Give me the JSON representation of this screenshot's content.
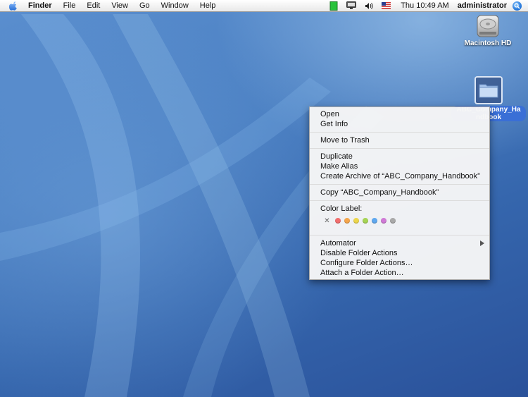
{
  "menubar": {
    "app_name": "Finder",
    "menus": [
      "File",
      "Edit",
      "View",
      "Go",
      "Window",
      "Help"
    ],
    "clock": "Thu 10:49 AM",
    "user": "administrator",
    "status_icons": [
      "battery-icon",
      "display-icon",
      "volume-icon",
      "us-flag-icon",
      "spotlight-icon"
    ]
  },
  "desktop": {
    "hd_label": "Macintosh HD",
    "folder_label": "ABC_Company_Handbook"
  },
  "context_menu": {
    "open": "Open",
    "get_info": "Get Info",
    "move_to_trash": "Move to Trash",
    "duplicate": "Duplicate",
    "make_alias": "Make Alias",
    "create_archive": "Create Archive of “ABC_Company_Handbook”",
    "copy": "Copy “ABC_Company_Handbook”",
    "color_label_title": "Color Label:",
    "color_labels": [
      {
        "name": "none",
        "color": "#888888"
      },
      {
        "name": "red",
        "color": "#f26d6d"
      },
      {
        "name": "orange",
        "color": "#f5a54b"
      },
      {
        "name": "yellow",
        "color": "#ecd64c"
      },
      {
        "name": "green",
        "color": "#a6d454"
      },
      {
        "name": "blue",
        "color": "#5fa8ef"
      },
      {
        "name": "purple",
        "color": "#d07ad6"
      },
      {
        "name": "gray",
        "color": "#a9a9a9"
      }
    ],
    "automator": "Automator",
    "disable_folder_actions": "Disable Folder Actions",
    "configure_folder_actions": "Configure Folder Actions…",
    "attach_folder_action": "Attach a Folder Action…"
  }
}
